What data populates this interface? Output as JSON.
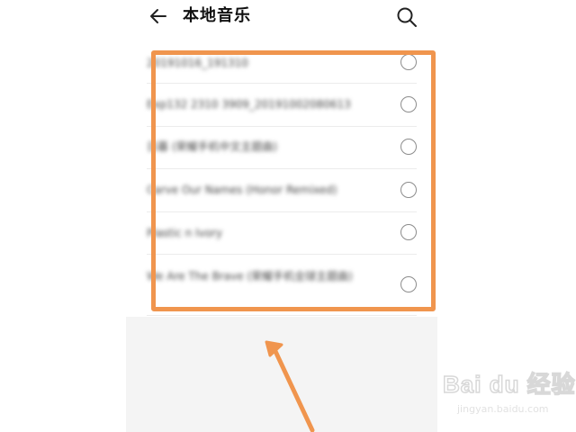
{
  "header": {
    "title": "本地音乐",
    "back_icon": "back-arrow-icon",
    "search_icon": "search-icon"
  },
  "songs": [
    "20191016_191310",
    "Exp132 2310 3909_20191002080613",
    "日暮 (荣耀手机中文主题曲)",
    "Carve Our Names (Honor Remixed)",
    "Plastic n Ivory",
    "We Are The Brave (荣耀手机全球主题曲)"
  ],
  "watermark": {
    "brand": "Bai du 经验",
    "sub": "jingyan.baidu.com"
  },
  "colors": {
    "highlight": "#f0954e",
    "background": "#f4f4f4"
  }
}
